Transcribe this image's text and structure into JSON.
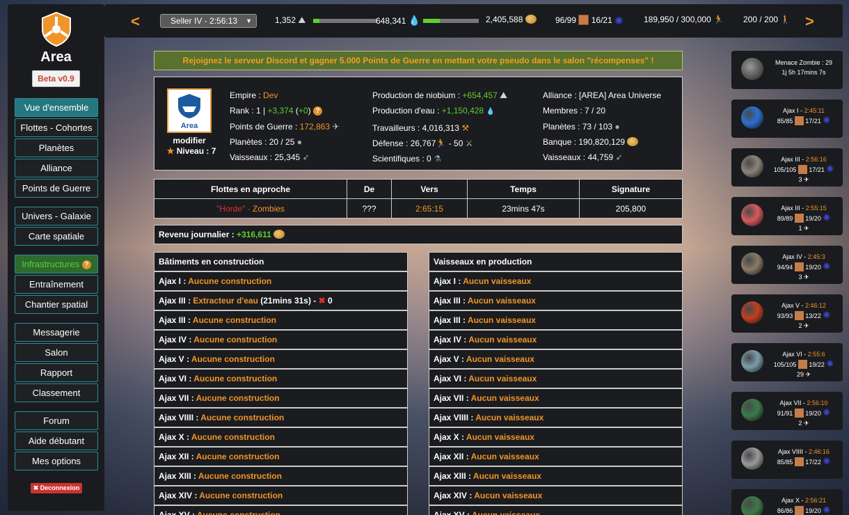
{
  "sidebar": {
    "logo_text": "Area",
    "beta_label": "Beta v0.9",
    "nav": [
      {
        "label": "Vue d'ensemble"
      },
      {
        "label": "Flottes - Cohortes"
      },
      {
        "label": "Planètes"
      },
      {
        "label": "Alliance"
      },
      {
        "label": "Points de Guerre"
      },
      {
        "label": "Univers - Galaxie"
      },
      {
        "label": "Carte spatiale"
      },
      {
        "label": "Infrastructures"
      },
      {
        "label": "Entraînement"
      },
      {
        "label": "Chantier spatial"
      },
      {
        "label": "Messagerie"
      },
      {
        "label": "Salon"
      },
      {
        "label": "Rapport"
      },
      {
        "label": "Classement"
      },
      {
        "label": "Forum"
      },
      {
        "label": "Aide débutant"
      },
      {
        "label": "Mes options"
      }
    ],
    "logout_label": "✖ Deconnexion"
  },
  "topbar": {
    "prev": "<",
    "next": ">",
    "planet_select": "Seller IV - 2:56:13",
    "niobium": "1,352",
    "niobium_fill": 0.1,
    "water": "648,341",
    "water_fill": 0.3,
    "money": "2,405,588",
    "workers_text": "96/99",
    "scientists_text": "16/21",
    "soldiers": "189,950 / 300,000",
    "population": "200 / 200"
  },
  "banner": "Rejoignez le serveur Discord et gagner 5.000 Points de Guerre en mettant votre pseudo dans le salon \"récompenses\" !",
  "empire": {
    "logo_name": "Area",
    "modify": "modifier",
    "level": "Niveau : 7",
    "col1": {
      "empire_label": "Empire : ",
      "empire": "Dev",
      "rank_label": "Rank : 1 | ",
      "rank_delta": "+3,374",
      "rank_open": " (",
      "rank_delta2": "+0",
      "rank_close": ")",
      "pg_label": "Points de Guerre : ",
      "pg": "172,863",
      "planets": "Planètes : 20 / 25",
      "ships": "Vaisseaux : 25,345"
    },
    "col2": {
      "niobium_label": "Production de niobium : ",
      "niobium": "+654,457",
      "water_label": "Production d'eau : ",
      "water": "+1,150,428",
      "workers": "Travailleurs : 4,016,313",
      "defense_a": "Défense : 26,767",
      "defense_b": " - 50",
      "scientists": "Scientifiques : 0"
    },
    "col3": {
      "alliance": "Alliance : [AREA] Area Universe",
      "members": "Membres : 7 / 20",
      "planets": "Planètes : 73 / 103",
      "bank": "Banque : 190,820,129",
      "ships": "Vaisseaux : 44,759"
    }
  },
  "fleets": {
    "headers": [
      "Flottes en approche",
      "De",
      "Vers",
      "Temps",
      "Signature"
    ],
    "row": {
      "name_a": "\"Horde\"",
      "name_sep": " - ",
      "name_b": "Zombies",
      "from": "???",
      "to": "2:65:15",
      "time": "23mins 47s",
      "signature": "205,800"
    }
  },
  "revenue": {
    "label": "Revenu journalier : ",
    "value": "+316,611"
  },
  "buildings": {
    "title": "Bâtiments en construction",
    "rows": [
      {
        "planet": "Ajax I : ",
        "status": "Aucune construction"
      },
      {
        "planet": "Ajax III : ",
        "status": "Extracteur d'eau",
        "extra": " (21mins 31s) - ",
        "cancel": "✖",
        "count": " 0"
      },
      {
        "planet": "Ajax III : ",
        "status": "Aucune construction"
      },
      {
        "planet": "Ajax IV : ",
        "status": "Aucune construction"
      },
      {
        "planet": "Ajax V : ",
        "status": "Aucune construction"
      },
      {
        "planet": "Ajax VI : ",
        "status": "Aucune construction"
      },
      {
        "planet": "Ajax VII : ",
        "status": "Aucune construction"
      },
      {
        "planet": "Ajax VIIII : ",
        "status": "Aucune construction"
      },
      {
        "planet": "Ajax X : ",
        "status": "Aucune construction"
      },
      {
        "planet": "Ajax XII : ",
        "status": "Aucune construction"
      },
      {
        "planet": "Ajax XIII : ",
        "status": "Aucune construction"
      },
      {
        "planet": "Ajax XIV : ",
        "status": "Aucune construction"
      },
      {
        "planet": "Ajax XV : ",
        "status": "Aucune construction"
      }
    ]
  },
  "ships": {
    "title": "Vaisseaux en production",
    "rows": [
      {
        "planet": "Ajax I : ",
        "status": "Aucun vaisseaux"
      },
      {
        "planet": "Ajax III : ",
        "status": "Aucun vaisseaux"
      },
      {
        "planet": "Ajax III : ",
        "status": "Aucun vaisseaux"
      },
      {
        "planet": "Ajax IV : ",
        "status": "Aucun vaisseaux"
      },
      {
        "planet": "Ajax V : ",
        "status": "Aucun vaisseaux"
      },
      {
        "planet": "Ajax VI : ",
        "status": "Aucun vaisseaux"
      },
      {
        "planet": "Ajax VII : ",
        "status": "Aucun vaisseaux"
      },
      {
        "planet": "Ajax VIIII : ",
        "status": "Aucun vaisseaux"
      },
      {
        "planet": "Ajax X : ",
        "status": "Aucun vaisseaux"
      },
      {
        "planet": "Ajax XII : ",
        "status": "Aucun vaisseaux"
      },
      {
        "planet": "Ajax XIII : ",
        "status": "Aucun vaisseaux"
      },
      {
        "planet": "Ajax XIV : ",
        "status": "Aucun vaisseaux"
      },
      {
        "planet": "Ajax XV : ",
        "status": "Aucun vaisseaux"
      }
    ]
  },
  "threat": {
    "title": "Menace Zombie : 29",
    "time": "1j 5h 17mins 7s"
  },
  "planets": [
    {
      "name": "Ajax I",
      "sep": " - ",
      "time": "2:45:11",
      "pop": "85/85",
      "sci": "17/21",
      "ships": "",
      "color": "#2d6fd0"
    },
    {
      "name": "Ajax III",
      "sep": " - ",
      "time": "2:56:16",
      "pop": "105/105",
      "sci": "17/21",
      "ships": "3",
      "color": "#8a8478"
    },
    {
      "name": "Ajax III",
      "sep": " - ",
      "time": "2:55:15",
      "pop": "89/89",
      "sci": "19/20",
      "ships": "1",
      "color": "#d85a5a"
    },
    {
      "name": "Ajax IV",
      "sep": " - ",
      "time": "2:45:3",
      "pop": "94/94",
      "sci": "19/20",
      "ships": "3",
      "color": "#8a7a66"
    },
    {
      "name": "Ajax V",
      "sep": " - ",
      "time": "2:46:12",
      "pop": "93/93",
      "sci": "13/22",
      "ships": "2",
      "color": "#c0401e"
    },
    {
      "name": "Ajax VI",
      "sep": " - ",
      "time": "2:55:6",
      "pop": "105/105",
      "sci": "19/22",
      "ships": "29",
      "color": "#7a9ea8"
    },
    {
      "name": "Ajax VII",
      "sep": " - ",
      "time": "2:56:10",
      "pop": "91/91",
      "sci": "19/20",
      "ships": "2",
      "color": "#3c7a4a"
    },
    {
      "name": "Ajax VIIII",
      "sep": " - ",
      "time": "2:46:16",
      "pop": "85/85",
      "sci": "17/22",
      "ships": "",
      "color": "#9a9a9a"
    },
    {
      "name": "Ajax X",
      "sep": " - ",
      "time": "2:56:21",
      "pop": "86/86",
      "sci": "19/20",
      "ships": "",
      "color": "#3c7a4a"
    }
  ]
}
